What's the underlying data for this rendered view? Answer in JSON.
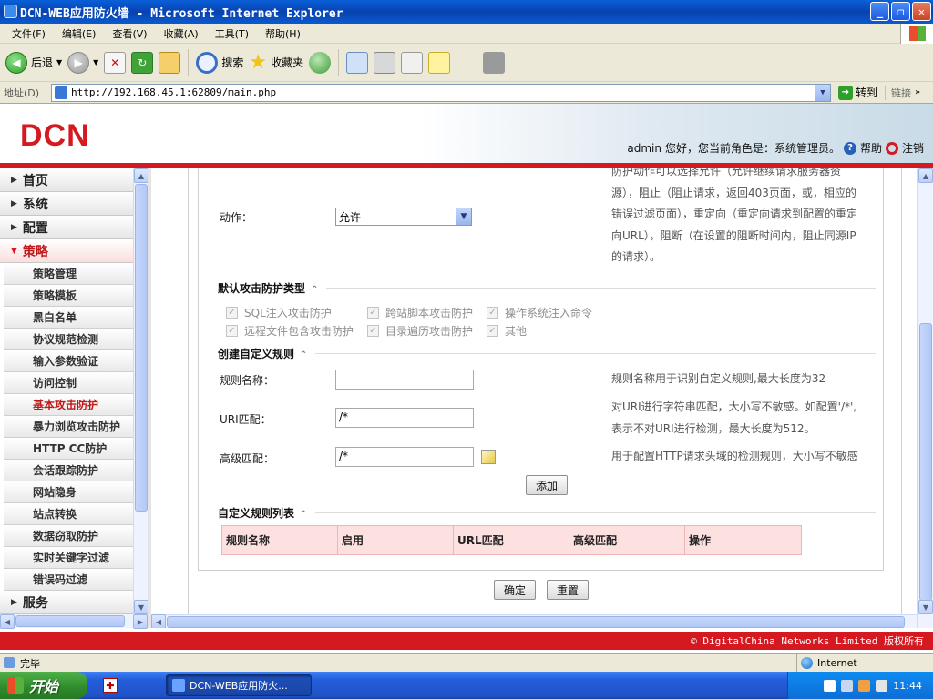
{
  "window": {
    "title": "DCN-WEB应用防火墙 - Microsoft Internet Explorer"
  },
  "menubar": [
    "文件(F)",
    "编辑(E)",
    "查看(V)",
    "收藏(A)",
    "工具(T)",
    "帮助(H)"
  ],
  "toolbar": {
    "back": "后退",
    "search": "搜索",
    "favorites": "收藏夹"
  },
  "addressbar": {
    "label": "地址(D)",
    "url": "http://192.168.45.1:62809/main.php",
    "go": "转到",
    "links": "链接"
  },
  "banner": {
    "logo": "DCN",
    "user": "admin",
    "greeting": "您好，您当前角色是：系统管理员。",
    "help": "帮助",
    "logout": "注销"
  },
  "sidebar": {
    "main": [
      {
        "label": "首页"
      },
      {
        "label": "系统"
      },
      {
        "label": "配置"
      },
      {
        "label": "策略"
      }
    ],
    "sub": [
      "策略管理",
      "策略模板",
      "黑白名单",
      "协议规范检测",
      "输入参数验证",
      "访问控制",
      "基本攻击防护",
      "暴力浏览攻击防护",
      "HTTP CC防护",
      "会话跟踪防护",
      "网站隐身",
      "站点转换",
      "数据窃取防护",
      "实时关键字过滤",
      "错误码过滤"
    ],
    "bottom": "服务",
    "active_sub": "基本攻击防护"
  },
  "form": {
    "action_label": "动作：",
    "action_value": "允许",
    "action_hint": [
      "防护动作可以选择允许（允许继续请求服务器资",
      "源），阻止（阻止请求，返回403页面，或，相应的",
      "错误过滤页面），重定向（重定向请求到配置的重定",
      "向URL），阻断（在设置的阻断时间内，阻止同源IP",
      "的请求）。"
    ],
    "default_types_title": "默认攻击防护类型",
    "checks": [
      "SQL注入攻击防护",
      "跨站脚本攻击防护",
      "操作系统注入命令",
      "远程文件包含攻击防护",
      "目录遍历攻击防护",
      "其他"
    ],
    "custom_title": "创建自定义规则",
    "rule_name_label": "规则名称：",
    "rule_name_hint": "规则名称用于识别自定义规则,最大长度为32",
    "uri_label": "URI匹配：",
    "uri_value": "/*",
    "uri_hint": [
      "对URI进行字符串匹配，大小写不敏感。如配置'/*',",
      "表示不对URI进行检测，最大长度为512。"
    ],
    "adv_label": "高级匹配：",
    "adv_value": "/*",
    "adv_hint": "用于配置HTTP请求头域的检测规则，大小写不敏感",
    "add_button": "添加",
    "list_title": "自定义规则列表",
    "columns": [
      "规则名称",
      "启用",
      "URL匹配",
      "高级匹配",
      "操作"
    ],
    "ok_button": "确定",
    "reset_button": "重置"
  },
  "footer": {
    "copyright": "© DigitalChina Networks Limited 版权所有"
  },
  "statusbar": {
    "status": "完毕",
    "zone": "Internet"
  },
  "taskbar": {
    "start": "开始",
    "task": "DCN-WEB应用防火...",
    "clock": "11:44"
  }
}
